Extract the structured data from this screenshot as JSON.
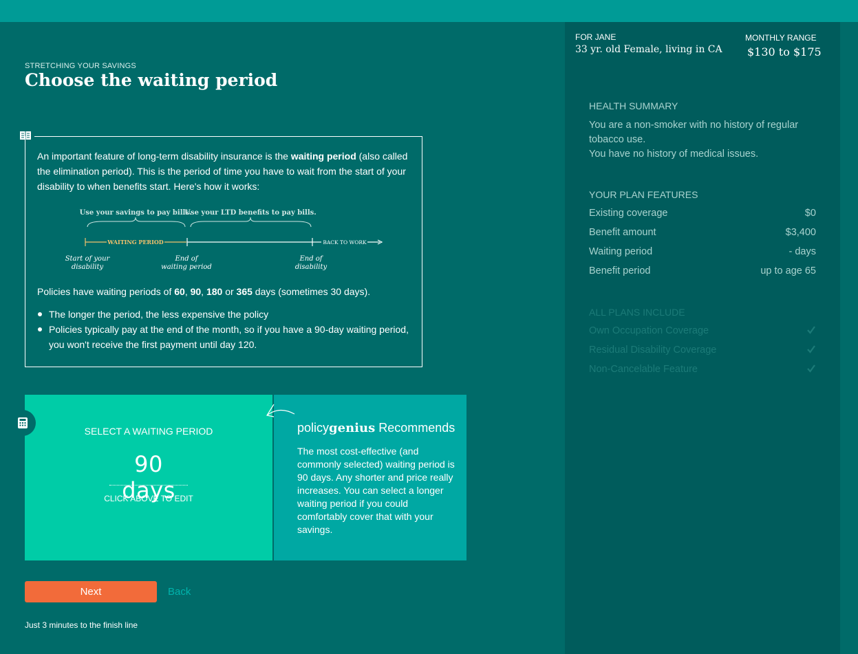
{
  "header": {
    "eyebrow": "STRETCHING YOUR SAVINGS",
    "title": "Choose the waiting period"
  },
  "info": {
    "intro_pre": "An important feature of long-term disability insurance is the ",
    "intro_bold": "waiting period",
    "intro_post": " (also called the elimination period). This is the period of time you have to wait from the start of your disability to when benefits start. Here's how it works:",
    "timeline": {
      "savings_label": "Use your savings to pay bills.",
      "ltd_label": "Use your LTD benefits to pay bills.",
      "waiting_label": "WAITING PERIOD",
      "back_to_work": "BACK TO WORK",
      "start_label_1": "Start of your",
      "start_label_2": "disability",
      "end_wait_1": "End of",
      "end_wait_2": "waiting period",
      "end_dis_1": "End of",
      "end_dis_2": "disability"
    },
    "policies_pre": "Policies have waiting periods of ",
    "p60": "60",
    "sep1": ", ",
    "p90": "90",
    "sep2": ", ",
    "p180": "180",
    "sep3": " or ",
    "p365": "365",
    "policies_post": " days (sometimes 30 days).",
    "bullets": [
      "The longer the period, the less expensive the policy",
      "Policies typically pay at the end of the month, so if you have a 90-day waiting period, you won't receive the first payment until day 120."
    ]
  },
  "selector": {
    "label": "SELECT A WAITING PERIOD",
    "value": "90 days",
    "hint": "CLICK ABOVE TO EDIT"
  },
  "recommend": {
    "brand_a": "policy",
    "brand_b": "genius",
    "title_suffix": " Recommends",
    "body": "The most cost-effective (and commonly selected) waiting period is 90 days. Any shorter and price really increases. You can select a longer waiting period if you could comfortably cover that with your savings."
  },
  "actions": {
    "next": "Next",
    "back": "Back",
    "finish_note": "Just 3 minutes to the finish line"
  },
  "sidebar": {
    "for_label": "FOR JANE",
    "for_desc": "33 yr. old Female, living in CA",
    "range_label": "MONTHLY RANGE",
    "range_value": "$130 to $175",
    "health_head": "HEALTH SUMMARY",
    "health_line1": "You are a non-smoker with no history of regular tobacco use.",
    "health_line2": "You have no history of medical issues.",
    "features_head": "YOUR PLAN FEATURES",
    "features": [
      {
        "label": "Existing coverage",
        "value": "$0"
      },
      {
        "label": "Benefit amount",
        "value": "$3,400"
      },
      {
        "label": "Waiting period",
        "value": "- days"
      },
      {
        "label": "Benefit period",
        "value": "up to age 65"
      }
    ],
    "includes_head": "ALL PLANS INCLUDE",
    "includes": [
      "Own Occupation Coverage",
      "Residual Disability Coverage",
      "Non-Cancelable Feature"
    ]
  },
  "colors": {
    "background": "#006b69",
    "topbar": "#009b96",
    "select_panel": "#00cca7",
    "recommend_panel": "#00a8a3",
    "sidebar": "#005c5c",
    "next_button": "#f26b3a",
    "waiting_accent": "#f5c26b"
  },
  "icons": [
    "book-icon",
    "calculator-icon",
    "arrow-icon",
    "checkmark-icon"
  ]
}
